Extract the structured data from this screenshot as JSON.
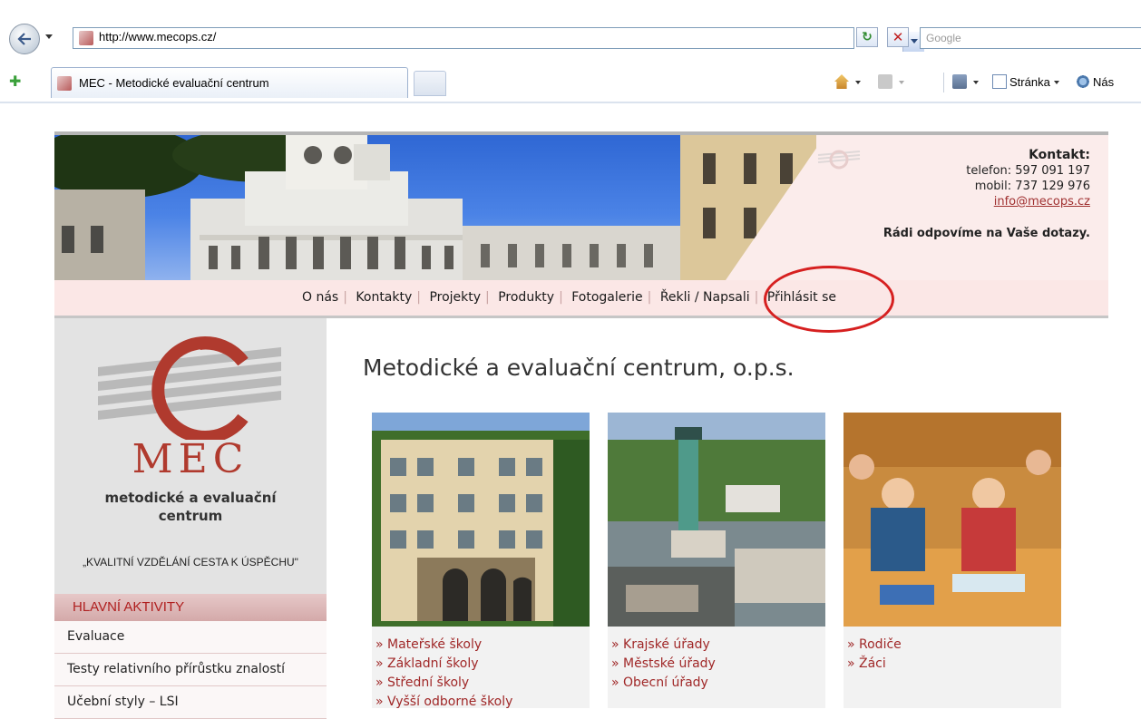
{
  "browser": {
    "url": "http://www.mecops.cz/",
    "search_placeholder": "Google",
    "tab_title": "MEC - Metodické evaluační centrum",
    "cmd_page": "Stránka",
    "cmd_tools": "Nás"
  },
  "contact": {
    "heading": "Kontakt:",
    "phone": "telefon: 597 091 197",
    "mobile": "mobil: 737 129 976",
    "email": "info@mecops.cz",
    "message": "Rádi odpovíme na Vaše dotazy."
  },
  "nav": {
    "items": [
      "O nás",
      "Kontakty",
      "Projekty",
      "Produkty",
      "Fotogalerie",
      "Řekli / Napsali",
      "Přihlásit se"
    ]
  },
  "sidebar": {
    "logo_letters": "MEC",
    "logo_line1": "metodické a evaluační",
    "logo_line2": "centrum",
    "motto": "„KVALITNÍ VZDĚLÁNÍ CESTA K ÚSPĚCHU\"",
    "activities_heading": "HLAVNÍ AKTIVITY",
    "activities": [
      "Evaluace",
      "Testy relativního přírůstku znalostí",
      "Učební styly – LSI"
    ]
  },
  "main": {
    "title": "Metodické a evaluační centrum, o.p.s.",
    "cards": [
      {
        "links": [
          "» Mateřské školy",
          "» Základní školy",
          "» Střední školy",
          "» Vyšší odborné školy"
        ]
      },
      {
        "links": [
          "» Krajské úřady",
          "» Městské úřady",
          "» Obecní úřady"
        ]
      },
      {
        "links": [
          "» Rodiče",
          "» Žáci"
        ]
      }
    ]
  },
  "colors": {
    "accent": "#a02828",
    "annotation": "#d62020",
    "header_bg": "#fbeceb"
  }
}
